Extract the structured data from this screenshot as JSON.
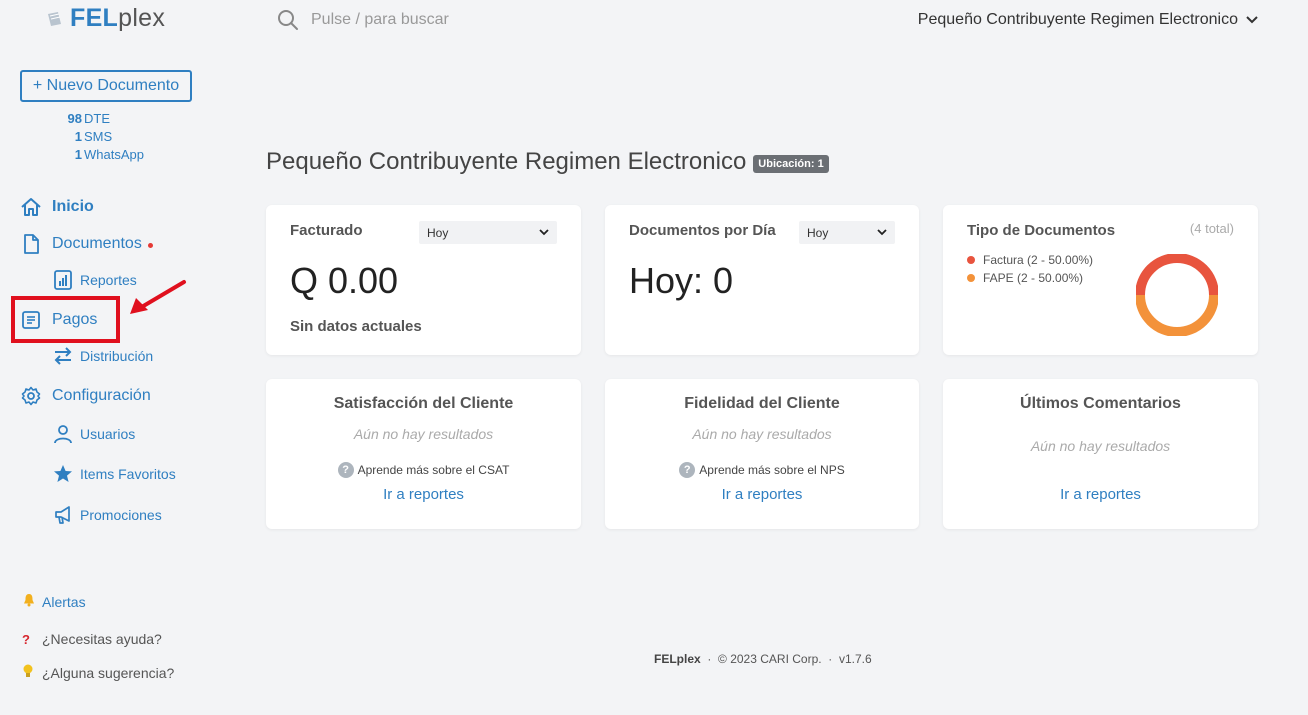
{
  "header": {
    "logo_fel": "FEL",
    "logo_plex": "plex",
    "search_placeholder": "Pulse / para buscar",
    "company_name": "Pequeño Contribuyente Regimen Electronico"
  },
  "sidebar": {
    "new_document": "+ Nuevo Documento",
    "counts": [
      {
        "num": "98",
        "label": "DTE"
      },
      {
        "num": "1",
        "label": "SMS"
      },
      {
        "num": "1",
        "label": "WhatsApp"
      }
    ],
    "nav": {
      "inicio": "Inicio",
      "documentos": "Documentos",
      "reportes": "Reportes",
      "pagos": "Pagos",
      "distribucion": "Distribución",
      "configuracion": "Configuración",
      "usuarios": "Usuarios",
      "items_favoritos": "Items Favoritos",
      "promociones": "Promociones"
    },
    "bottom": {
      "alertas": "Alertas",
      "ayuda": "¿Necesitas ayuda?",
      "sugerencia": "¿Alguna sugerencia?"
    }
  },
  "main": {
    "title": "Pequeño Contribuyente Regimen Electronico",
    "badge": "Ubicación: 1",
    "facturado": {
      "title": "Facturado",
      "select": "Hoy",
      "value": "Q 0.00",
      "sub": "Sin datos actuales"
    },
    "documentos_dia": {
      "title": "Documentos por Día",
      "select": "Hoy",
      "value": "Hoy: 0"
    },
    "tipo_documentos": {
      "title": "Tipo de Documentos",
      "total": "(4 total)",
      "legend": [
        {
          "label": "Factura (2 - 50.00%)",
          "color": "#e8543e"
        },
        {
          "label": "FAPE (2 - 50.00%)",
          "color": "#f3923a"
        }
      ]
    },
    "satisfaccion": {
      "title": "Satisfacción del Cliente",
      "empty": "Aún no hay resultados",
      "learn": "Aprende más sobre el CSAT",
      "link": "Ir a reportes"
    },
    "fidelidad": {
      "title": "Fidelidad del Cliente",
      "empty": "Aún no hay resultados",
      "learn": "Aprende más sobre el NPS",
      "link": "Ir a reportes"
    },
    "comentarios": {
      "title": "Últimos Comentarios",
      "empty": "Aún no hay resultados",
      "link": "Ir a reportes"
    }
  },
  "footer": {
    "brand": "FELplex",
    "copyright": "© 2023 CARI Corp.",
    "version": "v1.7.6"
  },
  "colors": {
    "accent": "#2f7fc1",
    "highlight": "#e0101e"
  }
}
